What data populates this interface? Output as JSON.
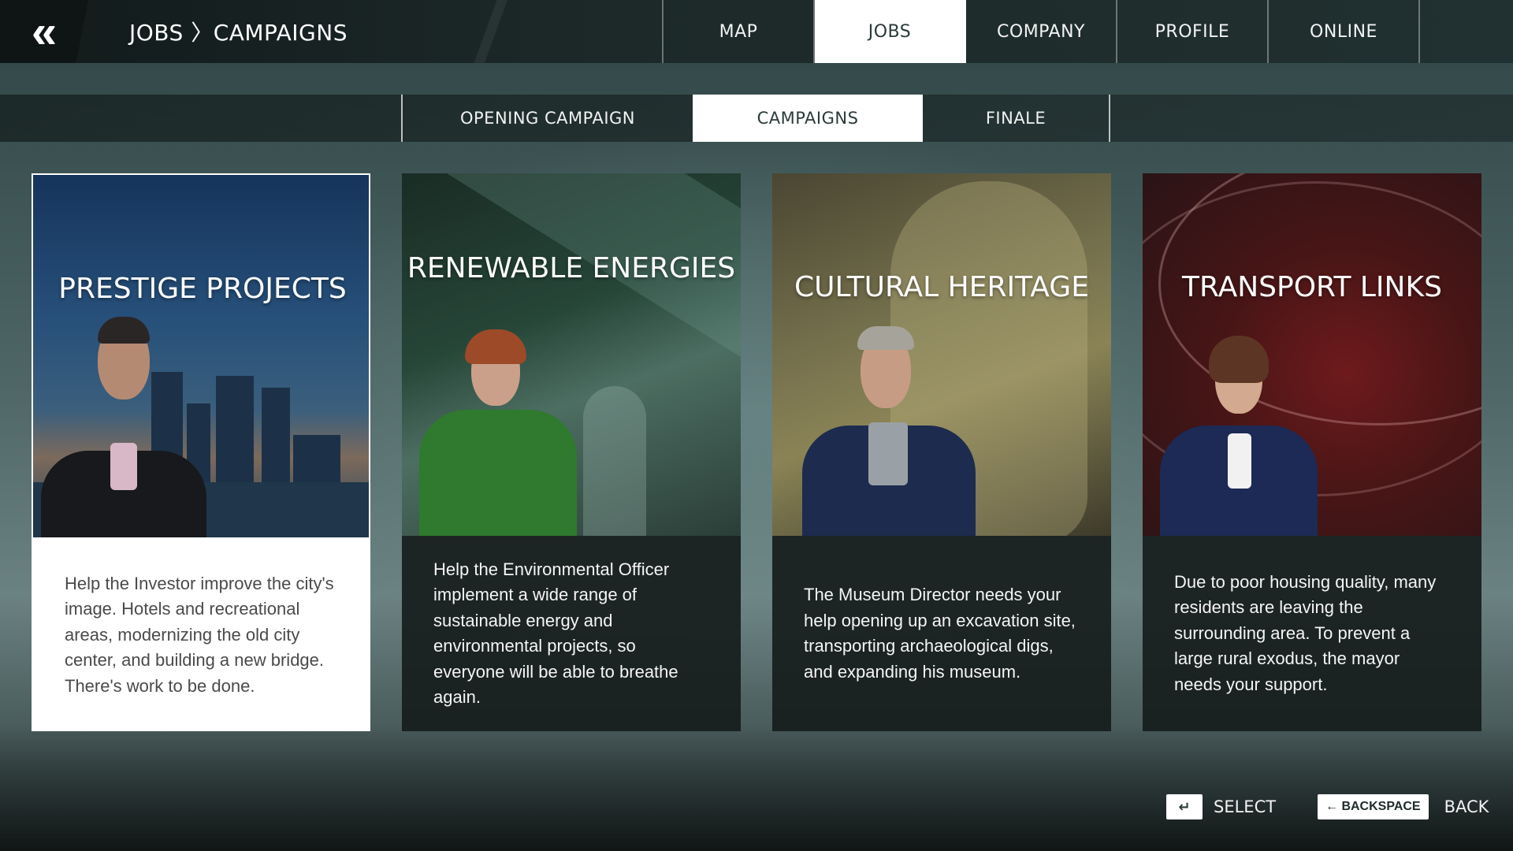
{
  "header": {
    "back_icon": "double-chevron-left-icon",
    "breadcrumb": "JOBS 〉CAMPAIGNS"
  },
  "main_tabs": [
    {
      "label": "MAP",
      "active": false
    },
    {
      "label": "JOBS",
      "active": true
    },
    {
      "label": "COMPANY",
      "active": false
    },
    {
      "label": "PROFILE",
      "active": false
    },
    {
      "label": "ONLINE",
      "active": false
    }
  ],
  "sub_tabs": [
    {
      "label": "OPENING CAMPAIGN",
      "active": false
    },
    {
      "label": "CAMPAIGNS",
      "active": true
    },
    {
      "label": "FINALE",
      "active": false
    }
  ],
  "cards": [
    {
      "title": "PRESTIGE PROJECTS",
      "description": "Help the Investor improve the city's image. Hotels and recreational areas, modernizing the old city center, and building a new bridge. There's work to be done.",
      "selected": true
    },
    {
      "title": "RENEWABLE ENERGIES",
      "description": "Help the Environmental Officer implement a wide range of sustainable energy and environmental projects, so everyone will be able to breathe again.",
      "selected": false
    },
    {
      "title": "CULTURAL HERITAGE",
      "description": "The Museum Director needs your help opening up an excavation site, transporting archaeological digs, and expanding his museum.",
      "selected": false
    },
    {
      "title": "TRANSPORT LINKS",
      "description": "Due to poor housing quality, many residents are leaving the surrounding area. To prevent a large rural exodus, the mayor needs your support.",
      "selected": false
    }
  ],
  "footer": {
    "select_key": "↵",
    "select_label": "SELECT",
    "back_key": "← BACKSPACE",
    "back_label": "BACK"
  },
  "colors": {
    "active_tab_bg": "#ffffff",
    "panel_dark": "#161c1c"
  }
}
